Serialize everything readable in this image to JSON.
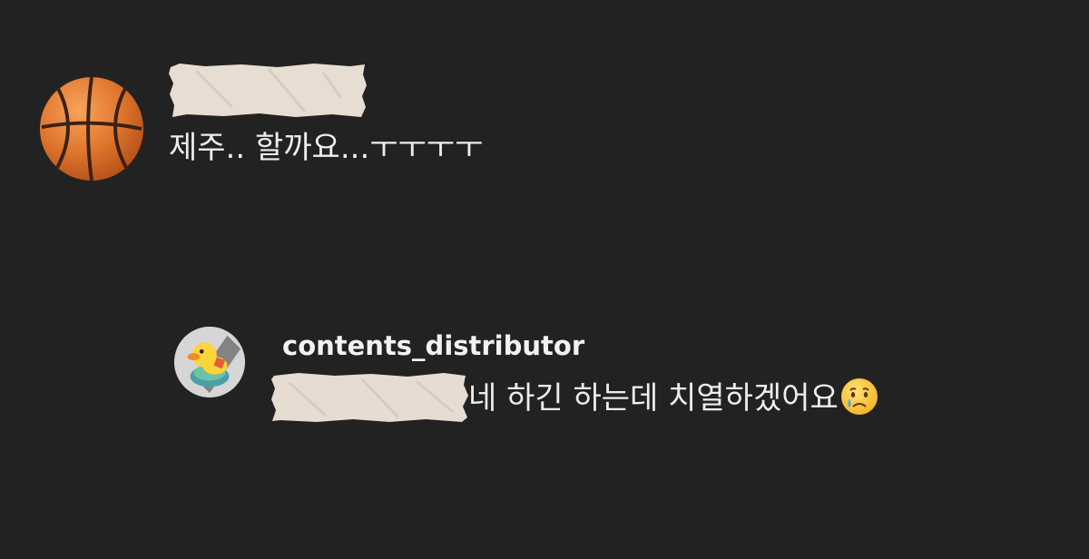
{
  "comments": [
    {
      "avatar_icon": "basketball-icon",
      "username_redacted": true,
      "text": "제주.. 할까요...ㅜㅜㅜㅜ"
    }
  ],
  "reply": {
    "avatar_icon": "rubber-duck-avatar",
    "username": "contents_distributor",
    "mention_redacted": true,
    "text": "네 하긴 하는데 치열하겠어요",
    "emoji": "crying-face-icon"
  },
  "colors": {
    "background": "#222222",
    "text": "#ededed",
    "tape": "#e6ddd3"
  }
}
